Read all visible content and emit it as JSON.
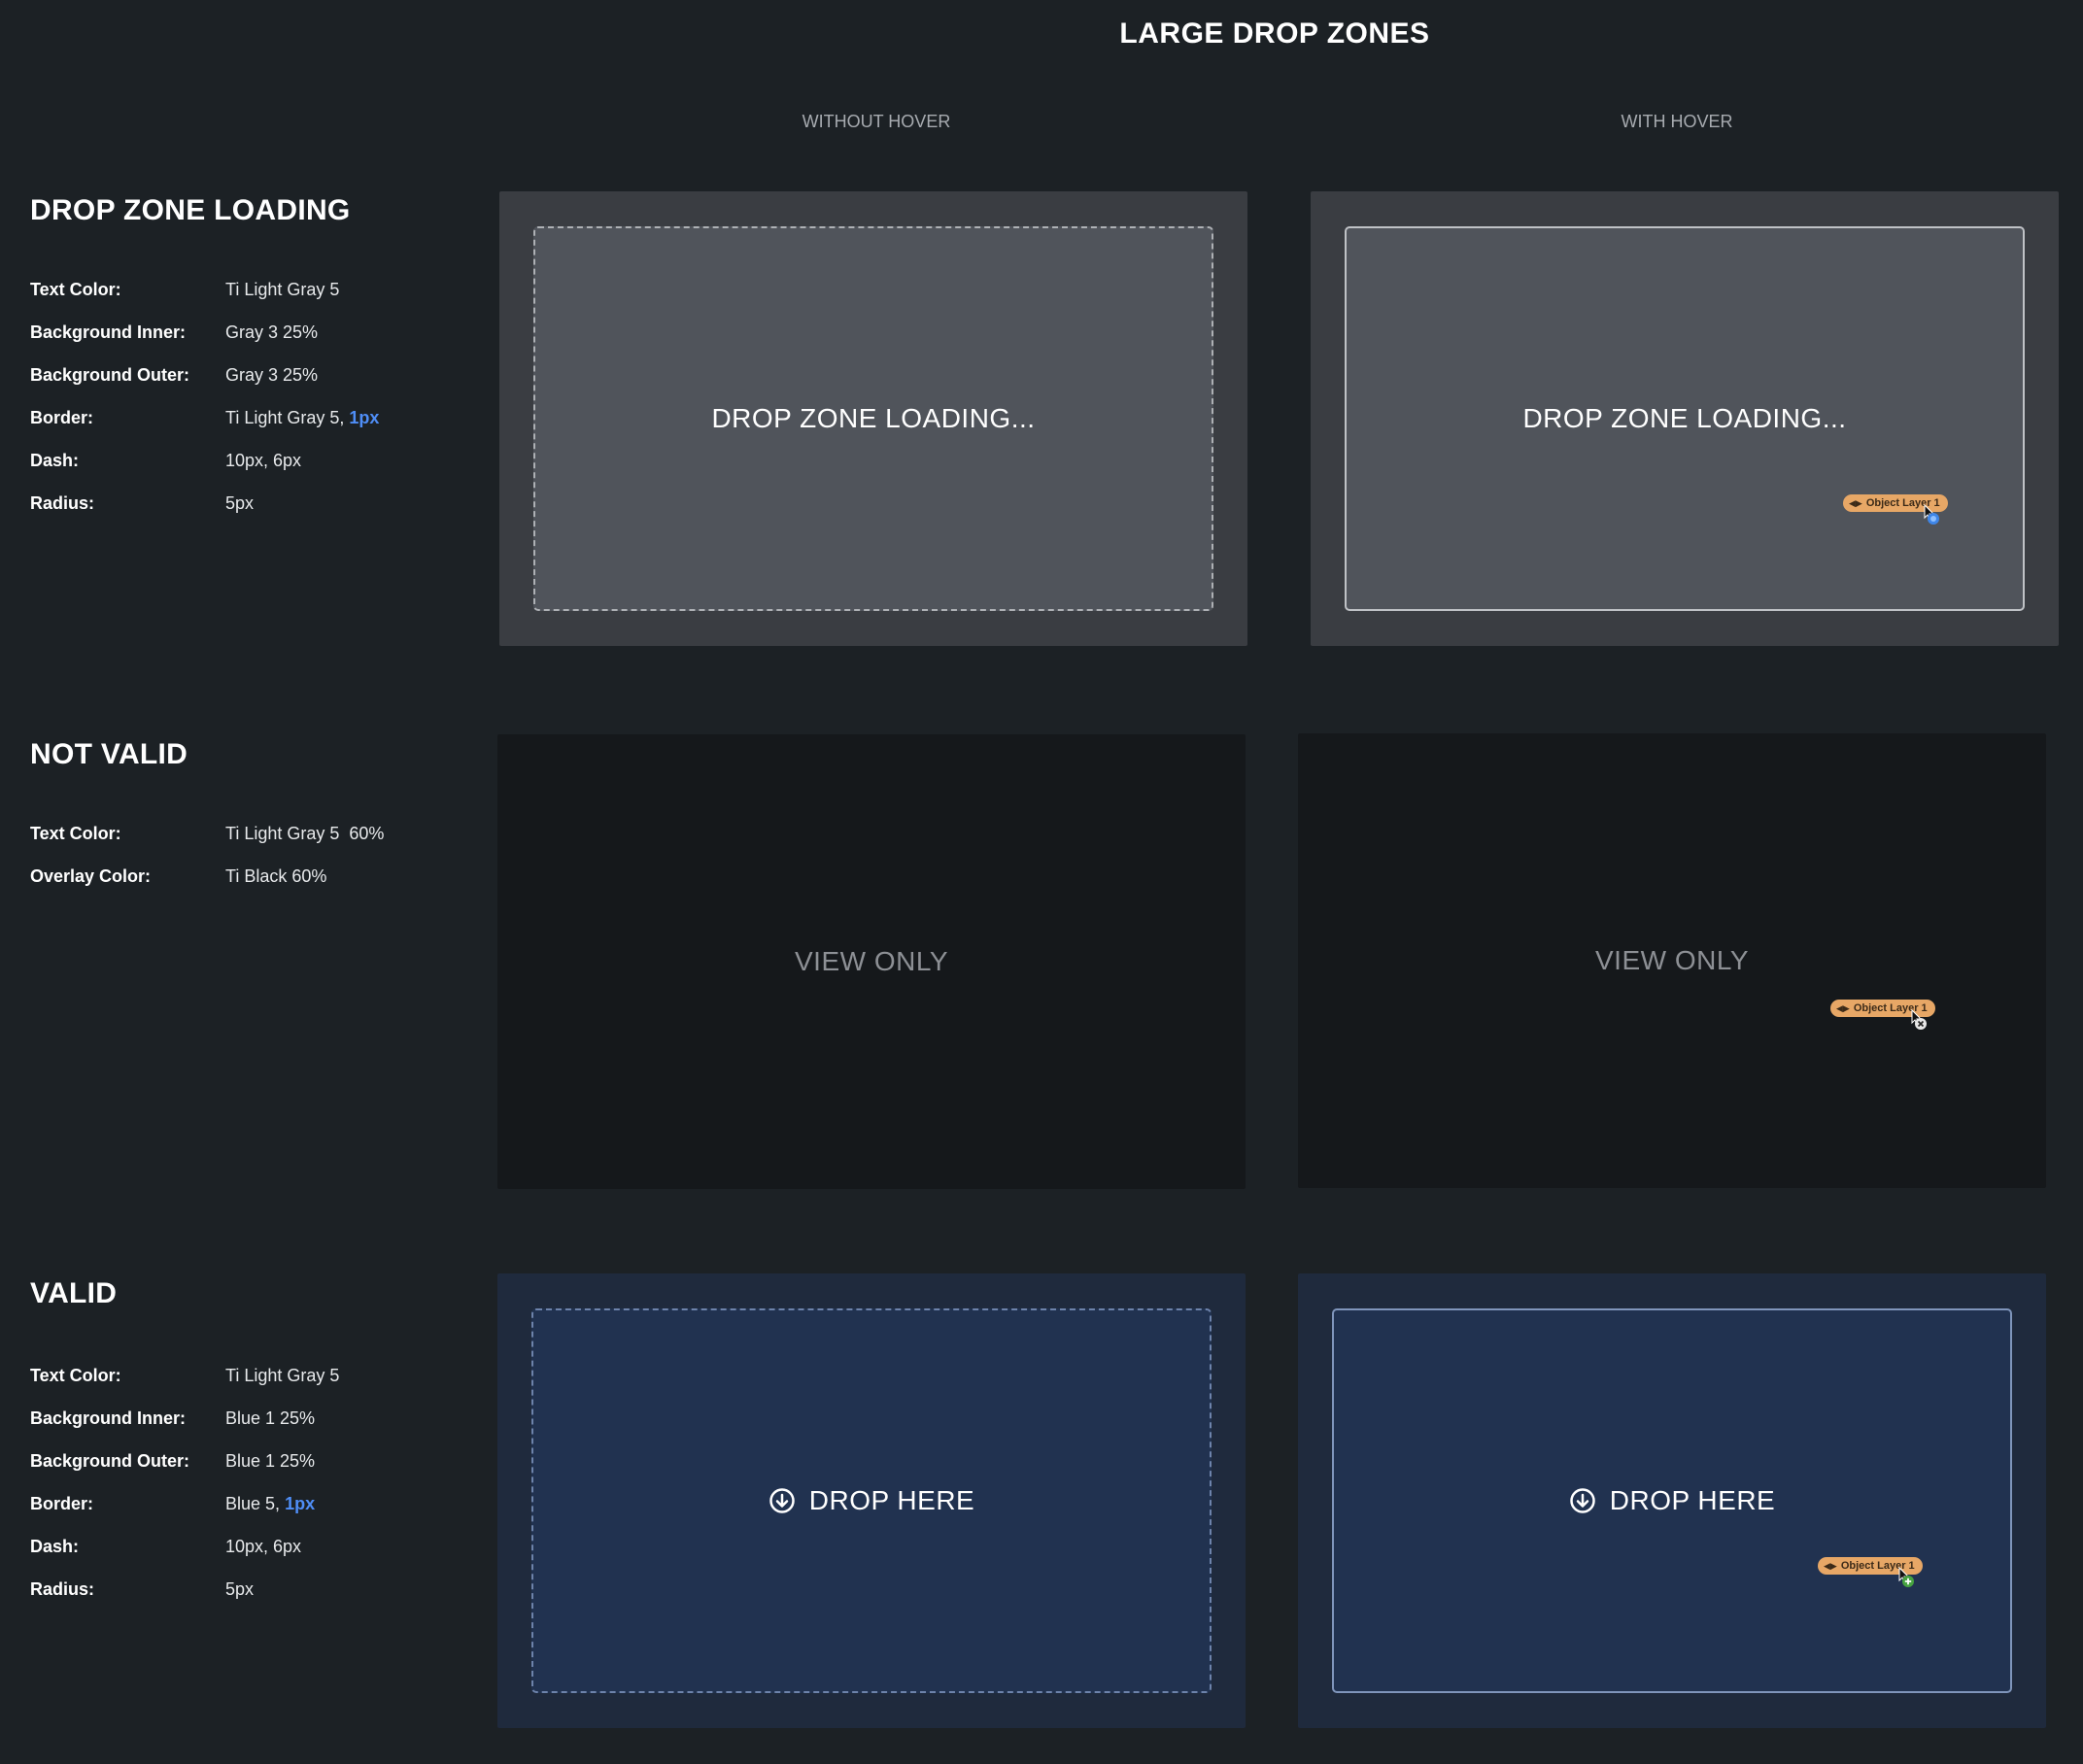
{
  "page_title": "LARGE DROP ZONES",
  "columns": {
    "without_hover": "WITHOUT HOVER",
    "with_hover": "WITH HOVER"
  },
  "sections": {
    "loading": {
      "heading": "DROP ZONE LOADING",
      "specs": [
        {
          "label": "Text Color:",
          "value": "Ti Light Gray 5"
        },
        {
          "label": "Background Inner:",
          "value": "Gray 3 25%"
        },
        {
          "label": "Background Outer:",
          "value": "Gray 3 25%"
        },
        {
          "label": "Border:",
          "value": "Ti Light Gray 5,",
          "accent": "1px"
        },
        {
          "label": "Dash:",
          "value": "10px, 6px"
        },
        {
          "label": "Radius:",
          "value": "5px"
        }
      ],
      "zone_text": "DROP ZONE LOADING..."
    },
    "not_valid": {
      "heading": "NOT VALID",
      "specs": [
        {
          "label": "Text Color:",
          "value": "Ti Light Gray 5  60%"
        },
        {
          "label": "Overlay Color:",
          "value": "Ti Black 60%"
        }
      ],
      "zone_text": "VIEW ONLY"
    },
    "valid": {
      "heading": "VALID",
      "specs": [
        {
          "label": "Text Color:",
          "value": "Ti Light Gray 5"
        },
        {
          "label": "Background Inner:",
          "value": "Blue 1 25%"
        },
        {
          "label": "Background Outer:",
          "value": "Blue 1 25%"
        },
        {
          "label": "Border:",
          "value": "Blue 5,",
          "accent": "1px"
        },
        {
          "label": "Dash:",
          "value": "10px, 6px"
        },
        {
          "label": "Radius:",
          "value": "5px"
        }
      ],
      "zone_text": "DROP HERE"
    }
  },
  "drag_chip_label": "Object Layer 1",
  "icons": {
    "drag": "eye-icon",
    "drop": "arrow-down-circle-icon",
    "loading_cursor": "loading-spinner-icon",
    "invalid_cursor": "not-allowed-icon",
    "valid_cursor": "plus-icon"
  },
  "colors": {
    "page_bg": "#1c2125",
    "loading_outer": "#3a3d42",
    "loading_inner": "#50545b",
    "overlay": "#15181b",
    "valid_outer": "#1f2a3d",
    "valid_inner": "#213250",
    "accent": "#4f8ef7",
    "chip": "#e7a766"
  }
}
